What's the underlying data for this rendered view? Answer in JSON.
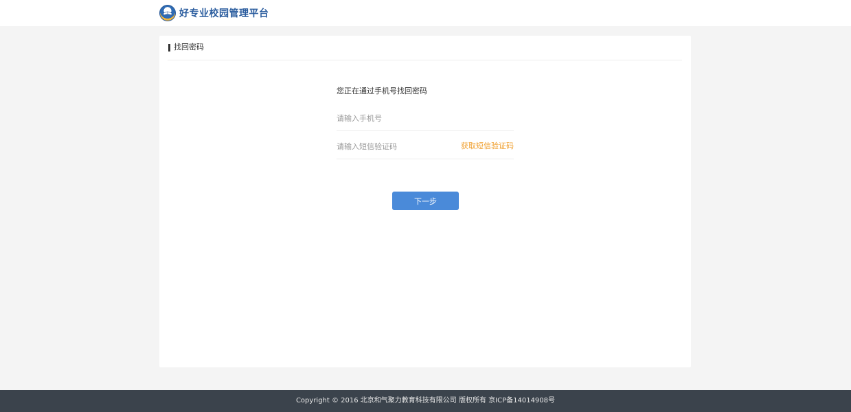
{
  "header": {
    "brand_name": "好专业校园管理平台",
    "logo_icon": "school-emblem-icon"
  },
  "card": {
    "title": "找回密码"
  },
  "form": {
    "heading": "您正在通过手机号找回密码",
    "phone": {
      "value": "",
      "placeholder": "请输入手机号"
    },
    "sms_code": {
      "value": "",
      "placeholder": "请输入短信验证码"
    },
    "get_code_label": "获取短信验证码",
    "next_label": "下一步"
  },
  "footer": {
    "copyright": "Copyright © 2016 北京和气聚力教育科技有限公司 版权所有 京ICP备14014908号"
  },
  "colors": {
    "brand": "#2a5c9e",
    "primary_button": "#4a8ad9",
    "link_orange": "#f0a030",
    "footer_bg": "#3b434c",
    "page_bg": "#f4f4f4"
  }
}
